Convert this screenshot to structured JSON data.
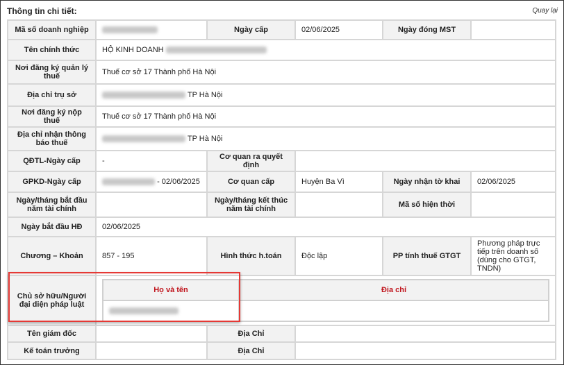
{
  "header": {
    "title": "Thông tin chi tiết:",
    "back_label": "Quay lại"
  },
  "rows": {
    "mst_label": "Mã số doanh nghiệp",
    "ngay_cap_label": "Ngày cấp",
    "ngay_cap_value": "02/06/2025",
    "ngay_dong_mst_label": "Ngày đóng MST",
    "ten_label": "Tên chính thức",
    "ten_value_prefix": "HỘ KINH DOANH",
    "noi_dk_ql_label": "Nơi đăng ký quản lý thuế",
    "noi_dk_ql_value": "Thuế cơ sở 17 Thành phố Hà Nội",
    "dia_chi_tru_so_label": "Địa chỉ trụ sở",
    "dia_chi_tru_so_suffix": "TP Hà Nội",
    "noi_dk_nop_label": "Nơi đăng ký nộp thuế",
    "noi_dk_nop_value": "Thuế cơ sở 17 Thành phố Hà Nội",
    "dia_chi_tb_label": "Địa chỉ nhận thông báo thuế",
    "dia_chi_tb_suffix": "TP Hà Nội",
    "qdtl_label": "QĐTL-Ngày cấp",
    "qdtl_value": "-",
    "co_quan_qd_label": "Cơ quan ra quyết định",
    "gpkd_label": "GPKD-Ngày cấp",
    "gpkd_suffix": "- 02/06/2025",
    "co_quan_cap_label": "Cơ quan cấp",
    "co_quan_cap_value": "Huyện Ba Vì",
    "ngay_nhan_label": "Ngày nhận tờ khai",
    "ngay_nhan_value": "02/06/2025",
    "bat_dau_tc_label": "Ngày/tháng bắt đầu năm tài chính",
    "ket_thuc_tc_label": "Ngày/tháng kết thúc năm tài chính",
    "ma_so_hien_thoi_label": "Mã số hiện thời",
    "ngay_bd_hd_label": "Ngày bắt đầu HĐ",
    "ngay_bd_hd_value": "02/06/2025",
    "chuong_label": "Chương – Khoản",
    "chuong_value": "857 - 195",
    "hinh_thuc_label": "Hình thức h.toán",
    "hinh_thuc_value": "Độc lập",
    "pp_label": "PP tính thuế GTGT",
    "pp_value": "Phương pháp trực tiếp trên doanh số (dùng cho GTGT, TNDN)",
    "chu_so_huu_label": "Chủ sở hữu/Người đại diện pháp luật",
    "ho_ten_header": "Họ và tên",
    "dia_chi_header": "Địa chỉ",
    "giam_doc_label": "Tên giám đốc",
    "dia_chi_gd_label": "Địa Chỉ",
    "ke_toan_label": "Kế toán trưởng",
    "dia_chi_kt_label": "Địa Chỉ"
  }
}
